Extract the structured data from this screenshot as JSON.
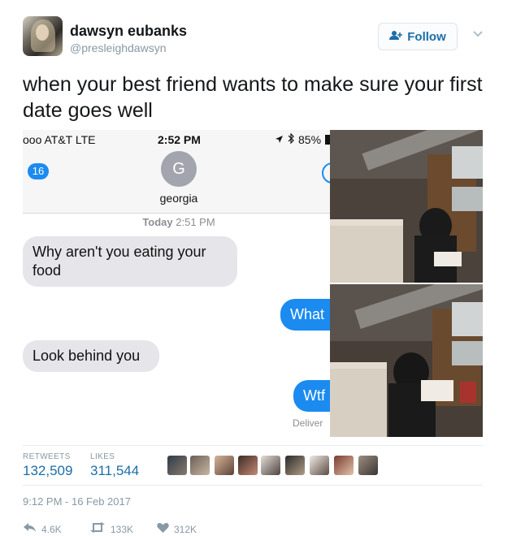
{
  "user": {
    "name": "dawsyn eubanks",
    "handle": "@presleighdawsyn",
    "follow_label": "Follow"
  },
  "tweet": {
    "text": "when your best friend wants to make sure your first date goes well"
  },
  "phone": {
    "status": {
      "carrier": "ooo AT&T  LTE",
      "time": "2:52 PM",
      "battery": "85%"
    },
    "back_count": "16",
    "contact_initial": "G",
    "contact_name": "georgia",
    "timestamp_day": "Today",
    "timestamp_time": "2:51 PM",
    "messages": [
      {
        "direction": "in",
        "text": "Why aren't you eating your food"
      },
      {
        "direction": "out",
        "text": "What"
      },
      {
        "direction": "in",
        "text": "Look behind you"
      },
      {
        "direction": "out",
        "text": "Wtf"
      }
    ],
    "delivered": "Deliver"
  },
  "stats": {
    "retweets_label": "RETWEETS",
    "retweets_value": "132,509",
    "likes_label": "LIKES",
    "likes_value": "311,544"
  },
  "meta": {
    "time": "9:12 PM - 16 Feb 2017"
  },
  "actions": {
    "reply_count": "4.6K",
    "retweet_count": "133K",
    "like_count": "312K"
  },
  "colors": {
    "twitter_blue": "#1c6ea6",
    "imessage_blue": "#1b8bf0",
    "incoming_bubble": "#e5e5ea",
    "muted": "#8899a6"
  },
  "icons": [
    "follow-person-icon",
    "chevron-down-icon",
    "location-arrow-icon",
    "bluetooth-icon",
    "battery-icon",
    "reply-icon",
    "retweet-icon",
    "heart-icon"
  ]
}
